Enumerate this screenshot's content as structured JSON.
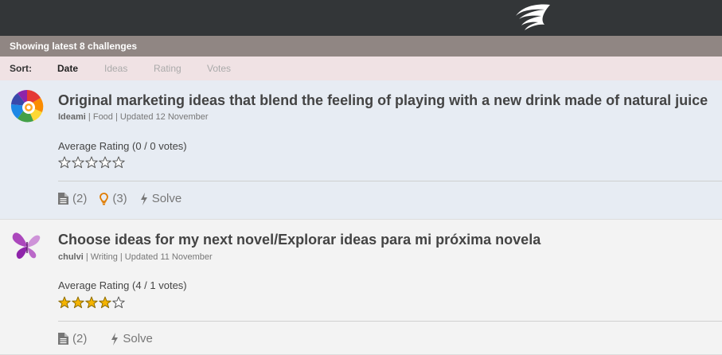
{
  "header": {
    "logo_icon": "wing-logo-icon"
  },
  "status": {
    "showing": "Showing latest 8 challenges"
  },
  "sort": {
    "label": "Sort:",
    "options": [
      "Date",
      "Ideas",
      "Rating",
      "Votes"
    ],
    "active": "Date"
  },
  "challenges": [
    {
      "logo_icon": "rainbow-swirl-logo-icon",
      "title": "Original marketing ideas that blend the feeling of playing with a new drink made of natural juice",
      "author": "Ideami",
      "sep1": " | ",
      "category": "Food",
      "sep2": " | ",
      "updated": "Updated 12 November",
      "rating_text": "Average Rating (0 / 0 votes)",
      "rating": 0,
      "max_rating": 5,
      "docs_count": "(2)",
      "ideas_count": "(3)",
      "solve_label": "Solve"
    },
    {
      "logo_icon": "purple-butterfly-logo-icon",
      "title": "Choose ideas for my next novel/Explorar ideas para mi próxima novela",
      "author": "chulvi",
      "sep1": " | ",
      "category": "Writing",
      "sep2": " | ",
      "updated": "Updated 11 November",
      "rating_text": "Average Rating (4 / 1 votes)",
      "rating": 4,
      "max_rating": 5,
      "docs_count": "(2)",
      "solve_label": "Solve"
    }
  ],
  "colors": {
    "topbar": "#333638",
    "showing_bar": "#908683",
    "sort_bar": "#f0e2e4",
    "card_highlight": "#e7ecf3",
    "star_filled": "#f5b400",
    "idea_bulb": "#e07b00"
  }
}
